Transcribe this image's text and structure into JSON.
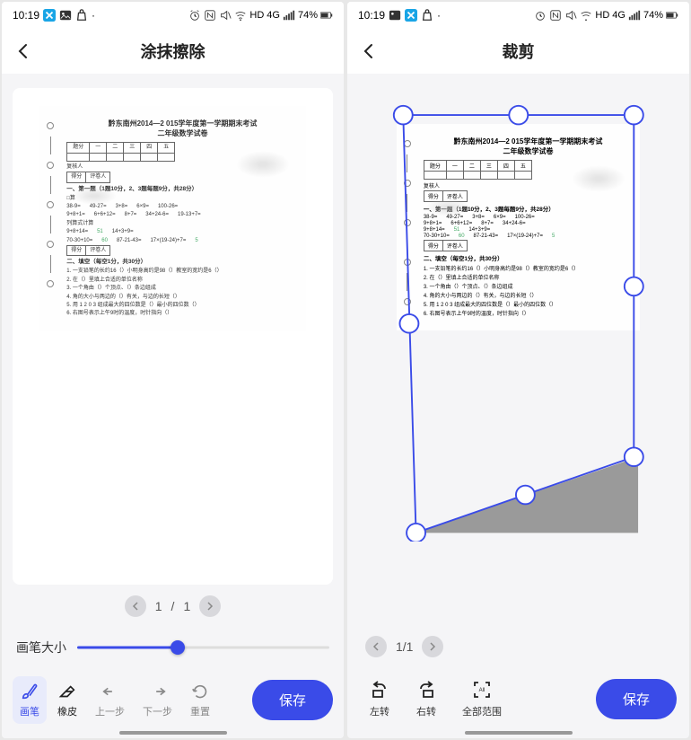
{
  "status": {
    "time": "10:19",
    "net": "HD",
    "sig": "4G",
    "batt": "74%"
  },
  "left": {
    "title": "涂抹擦除",
    "pager": {
      "cur": "1",
      "sep": "/",
      "total": "1"
    },
    "slider_label": "画笔大小",
    "tools": {
      "brush": "画笔",
      "eraser": "橡皮",
      "undo": "上一步",
      "redo": "下一步",
      "reset": "重置"
    },
    "save": "保存"
  },
  "right": {
    "title": "裁剪",
    "pager": {
      "text": "1/1"
    },
    "tools": {
      "rot_left": "左转",
      "rot_right": "右转",
      "all_range": "全部范围"
    },
    "save": "保存"
  },
  "doc": {
    "head1": "黔东南州2014—2 015学年度第一学期期末考试",
    "head2": "二年级数学试卷",
    "row_t": "题分",
    "row_f": "复核人",
    "scorebox1": "得分",
    "scorebox2": "评卷人",
    "sec1": "一、第一题（1题10分，2、3题每题9分，共28分）",
    "sec2": "二、填空（每空1分，共30分）",
    "lines": [
      "1. 一支铅笔的长约16（）小明身高约是98（）教室的宽约是6（）",
      "2. 在（）里填上合适的单位名称",
      "3. 一个角由（）个顶点、（）条边组成",
      "4. 角的大小与两边的（）有关，与边的长短（）",
      "5. 用 1 2 0 3 组成最大的四位数是（）最小的四位数（）",
      "6. 右图号表示上午9时的温度，时针指向（）"
    ],
    "calc": {
      "r1": [
        "38-9=",
        "49-27=",
        "3+8=",
        "6×9=",
        "100-26="
      ],
      "r2": [
        "9+8+1=",
        "6+6+12=",
        "8+7=",
        "34+24-6=",
        "19-13+7="
      ],
      "r3_label": "列算式计算",
      "r3_a": "9+8+14=",
      "r3_av": "51",
      "r3_b": "14+3+9=",
      "r4_a": "70-30+10=",
      "r4_av": "60",
      "r4_b": "87-21-43=",
      "r4_c": "17×(19-24)+7=",
      "r4_cv": "5"
    }
  }
}
